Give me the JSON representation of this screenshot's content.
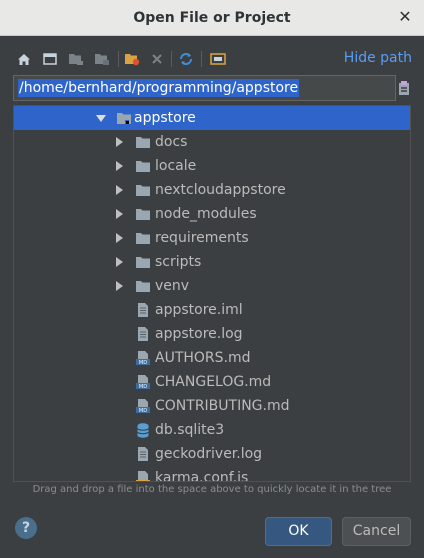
{
  "window": {
    "title": "Open File or Project",
    "close_glyph": "✕"
  },
  "toolbar": {
    "buttons": [
      {
        "icon": "home-icon"
      },
      {
        "icon": "desktop-icon"
      },
      {
        "icon": "project-folder-icon"
      },
      {
        "icon": "module-folder-icon"
      },
      {
        "icon": "new-folder-icon"
      },
      {
        "icon": "delete-icon"
      },
      {
        "icon": "refresh-icon"
      },
      {
        "icon": "show-hidden-icon"
      }
    ],
    "hide_path_label": "Hide path"
  },
  "path": {
    "value": "/home/bernhard/programming/appstore"
  },
  "tree": {
    "items": [
      {
        "label": "appstore",
        "type": "folder-open",
        "expanded": true,
        "selected": true
      },
      {
        "label": "docs",
        "type": "folder"
      },
      {
        "label": "locale",
        "type": "folder"
      },
      {
        "label": "nextcloudappstore",
        "type": "folder"
      },
      {
        "label": "node_modules",
        "type": "folder"
      },
      {
        "label": "requirements",
        "type": "folder"
      },
      {
        "label": "scripts",
        "type": "folder"
      },
      {
        "label": "venv",
        "type": "folder"
      },
      {
        "label": "appstore.iml",
        "type": "file"
      },
      {
        "label": "appstore.log",
        "type": "file"
      },
      {
        "label": "AUTHORS.md",
        "type": "markdown"
      },
      {
        "label": "CHANGELOG.md",
        "type": "markdown"
      },
      {
        "label": "CONTRIBUTING.md",
        "type": "markdown"
      },
      {
        "label": "db.sqlite3",
        "type": "database"
      },
      {
        "label": "geckodriver.log",
        "type": "file"
      },
      {
        "label": "karma.conf.js",
        "type": "js"
      }
    ]
  },
  "hint": "Drag and drop a file into the space above to quickly locate it in the tree",
  "buttons": {
    "help_label": "?",
    "ok_label": "OK",
    "cancel_label": "Cancel"
  },
  "colors": {
    "background": "#3c3f41",
    "selection": "#2f65ca",
    "link": "#589df6",
    "folder": "#9aa7b0",
    "markdown_badge": "#3d6d9e"
  }
}
